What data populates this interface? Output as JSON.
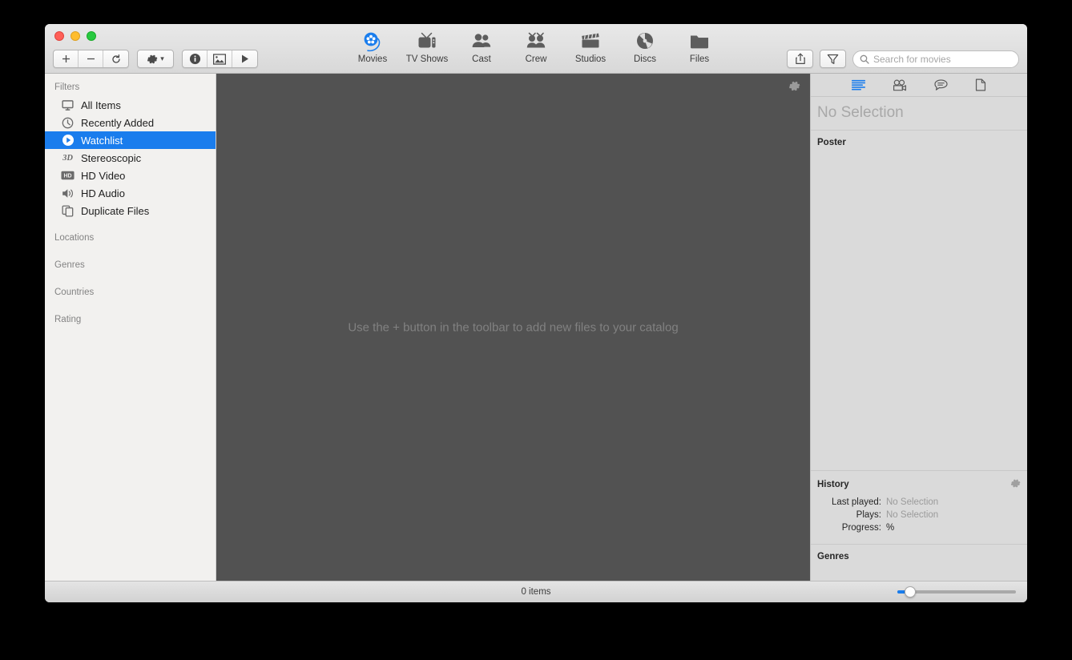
{
  "window": {
    "traffic_lights": [
      "close",
      "minimize",
      "maximize"
    ]
  },
  "toolbar": {
    "left_buttons": [
      {
        "name": "add",
        "glyph": "+"
      },
      {
        "name": "remove",
        "glyph": "−"
      },
      {
        "name": "refresh",
        "glyph": "↻"
      }
    ],
    "action_button": {
      "name": "action-gear",
      "glyph": "⚙",
      "chevron": "⌄"
    },
    "view_buttons": [
      {
        "name": "info",
        "glyph": "ⓘ"
      },
      {
        "name": "image",
        "glyph": "Ὓc"
      },
      {
        "name": "play",
        "glyph": "▶"
      }
    ],
    "categories": [
      {
        "label": "Movies",
        "icon": "film-reel-icon",
        "active": true
      },
      {
        "label": "TV Shows",
        "icon": "television-icon",
        "active": false
      },
      {
        "label": "Cast",
        "icon": "people-icon",
        "active": false
      },
      {
        "label": "Crew",
        "icon": "crew-icon",
        "active": false
      },
      {
        "label": "Studios",
        "icon": "clapperboard-icon",
        "active": false
      },
      {
        "label": "Discs",
        "icon": "disc-icon",
        "active": false
      },
      {
        "label": "Files",
        "icon": "folder-icon",
        "active": false
      }
    ],
    "share_button": "share-icon",
    "filter_button": "funnel-icon",
    "search": {
      "placeholder": "Search for movies",
      "value": ""
    }
  },
  "sidebar": {
    "sections": [
      {
        "header": "Filters",
        "items": [
          {
            "label": "All Items",
            "icon": "monitor-icon",
            "selected": false
          },
          {
            "label": "Recently Added",
            "icon": "clock-icon",
            "selected": false
          },
          {
            "label": "Watchlist",
            "icon": "play-circle-icon",
            "selected": true
          },
          {
            "label": "Stereoscopic",
            "icon": "3d-icon",
            "selected": false
          },
          {
            "label": "HD Video",
            "icon": "hd-badge-icon",
            "selected": false
          },
          {
            "label": "HD Audio",
            "icon": "speaker-icon",
            "selected": false
          },
          {
            "label": "Duplicate Files",
            "icon": "duplicate-icon",
            "selected": false
          }
        ]
      },
      {
        "header": "Locations",
        "items": []
      },
      {
        "header": "Genres",
        "items": []
      },
      {
        "header": "Countries",
        "items": []
      },
      {
        "header": "Rating",
        "items": []
      }
    ]
  },
  "content": {
    "empty_message": "Use the + button in the toolbar to add new files to your catalog",
    "gear_icon": "gear-icon"
  },
  "inspector": {
    "tabs": [
      {
        "icon": "info-list-icon",
        "active": true
      },
      {
        "icon": "movie-camera-icon",
        "active": false
      },
      {
        "icon": "speech-bubble-icon",
        "active": false
      },
      {
        "icon": "document-icon",
        "active": false
      }
    ],
    "title": "No Selection",
    "poster_label": "Poster",
    "history": {
      "label": "History",
      "gear_icon": "gear-icon",
      "rows": [
        {
          "key": "Last played:",
          "value": "No Selection",
          "dim": true
        },
        {
          "key": "Plays:",
          "value": "No Selection",
          "dim": true
        },
        {
          "key": "Progress:",
          "value": "%",
          "dim": false
        }
      ]
    },
    "genres_label": "Genres"
  },
  "status": {
    "item_count": "0 items",
    "zoom_percent": 7
  },
  "colors": {
    "accent": "#1a7ded",
    "sidebar_bg": "#f2f1ef",
    "content_bg": "#525252",
    "inspector_bg": "#dadada"
  }
}
